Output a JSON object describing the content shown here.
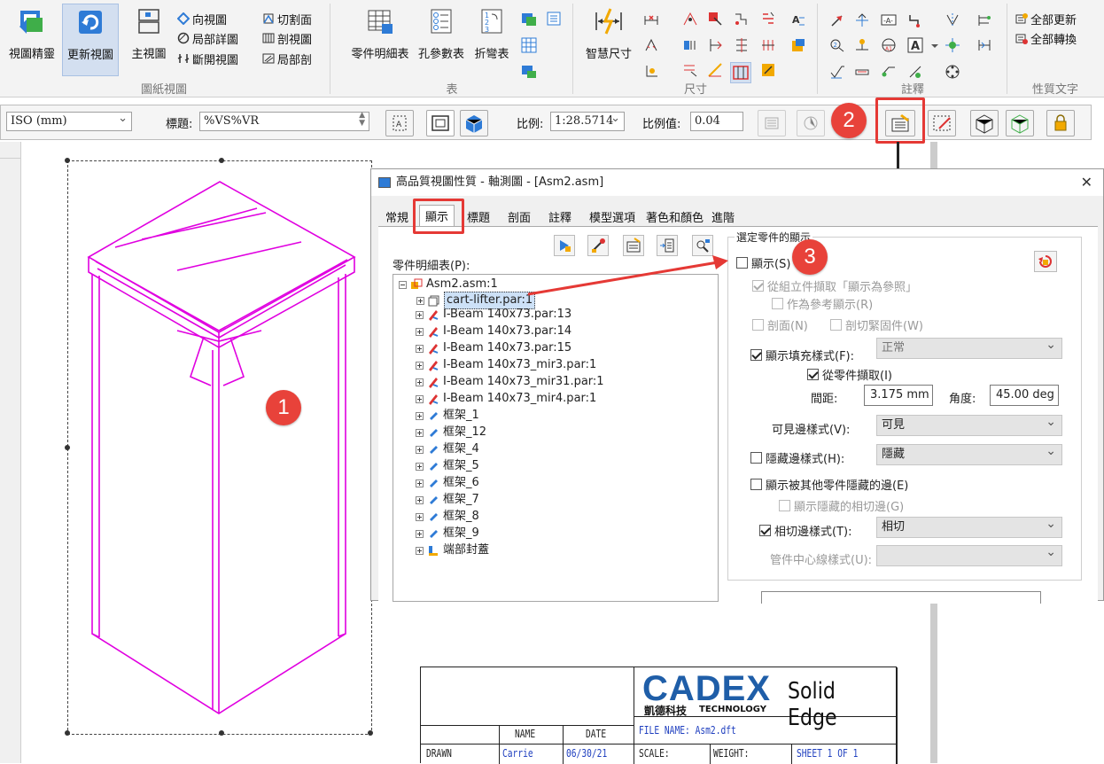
{
  "ribbon": {
    "groups": [
      {
        "label": "圖紙視圖"
      },
      {
        "label": "表"
      },
      {
        "label": "尺寸"
      },
      {
        "label": "註釋"
      },
      {
        "label": "性質文字"
      }
    ],
    "view_wizard": "視圖精靈",
    "update_views": "更新視圖",
    "principal_view": "主視圖",
    "auxiliary_view": "向視圖",
    "detail_view": "局部詳圖",
    "broken_view": "斷開視圖",
    "cutting_plane": "切割面",
    "section_view": "剖視圖",
    "broken_out": "局部剖",
    "parts_list": "零件明細表",
    "hole_table": "孔參數表",
    "bend_table": "折彎表",
    "smart_dimension": "智慧尺寸",
    "update_all": "全部更新",
    "convert_all": "全部轉換"
  },
  "cmdbar": {
    "standard": "ISO (mm)",
    "caption_label": "標題:",
    "caption_value": "%VS%VR",
    "scale_label": "比例:",
    "scale_value": "1:28.5714",
    "scale_val_label": "比例值:",
    "scale_val_value": "0.04"
  },
  "dialog": {
    "title": "高品質視圖性質 - 軸測圖 - [Asm2.asm]",
    "tabs": [
      "常規",
      "顯示",
      "標題",
      "剖面",
      "註釋",
      "模型選項",
      "著色和顏色",
      "進階"
    ],
    "parts_list_label": "零件明細表(P):",
    "tree": [
      {
        "label": "Asm2.asm:1",
        "icon": "assembly-icon"
      },
      {
        "label": "cart-lifter.par:1",
        "icon": "part-icon"
      },
      {
        "label": "I-Beam 140x73.par:13",
        "icon": "beam-icon"
      },
      {
        "label": "I-Beam 140x73.par:14",
        "icon": "beam-icon"
      },
      {
        "label": "I-Beam 140x73.par:15",
        "icon": "beam-icon"
      },
      {
        "label": "I-Beam 140x73_mir3.par:1",
        "icon": "beam-icon"
      },
      {
        "label": "I-Beam 140x73_mir31.par:1",
        "icon": "beam-icon"
      },
      {
        "label": "I-Beam 140x73_mir4.par:1",
        "icon": "beam-icon"
      },
      {
        "label": "框架_1",
        "icon": "frame-icon"
      },
      {
        "label": "框架_12",
        "icon": "frame-icon"
      },
      {
        "label": "框架_4",
        "icon": "frame-icon"
      },
      {
        "label": "框架_5",
        "icon": "frame-icon"
      },
      {
        "label": "框架_6",
        "icon": "frame-icon"
      },
      {
        "label": "框架_7",
        "icon": "frame-icon"
      },
      {
        "label": "框架_8",
        "icon": "frame-icon"
      },
      {
        "label": "框架_9",
        "icon": "frame-icon"
      },
      {
        "label": "端部封蓋",
        "icon": "endcap-icon"
      }
    ],
    "group_title": "選定零件的顯示",
    "show": "顯示(S)",
    "from_asm": "從組立件擷取「顯示為參照」",
    "as_ref": "作為參考顯示(R)",
    "section": "剖面(N)",
    "cut_fasteners": "剖切緊固件(W)",
    "show_fill": "顯示填充樣式(F):",
    "fill_value": "正常",
    "from_part": "從零件擷取(I)",
    "spacing_label": "間距:",
    "spacing_value": "3.175 mm",
    "angle_label": "角度:",
    "angle_value": "45.00 deg",
    "visible_edge_label": "可見邊樣式(V):",
    "visible_edge_value": "可見",
    "hidden_edge_label": "隱藏邊樣式(H):",
    "hidden_edge_value": "隱藏",
    "show_hidden_by_other": "顯示被其他零件隱藏的邊(E)",
    "show_hidden_tangent": "顯示隱藏的相切邊(G)",
    "tangent_edge_label": "相切邊樣式(T):",
    "tangent_edge_value": "相切",
    "tube_center_label": "管件中心線樣式(U):"
  },
  "badges": [
    "1",
    "2",
    "3"
  ],
  "titleblock": {
    "logo": "CADEX",
    "logo_cn": "凱德科技",
    "logo_en": "TECHNOLOGY",
    "product": "Solid Edge",
    "name_hdr": "NAME",
    "date_hdr": "DATE",
    "drawn": "DRAWN",
    "drawn_name": "Carrie",
    "drawn_date": "06/30/21",
    "file_name": "FILE NAME: Asm2.dft",
    "scale": "SCALE:",
    "weight": "WEIGHT:",
    "sheet": "SHEET 1 OF 1"
  },
  "colors": {
    "accent_red": "#e53935",
    "model_magenta": "#e000e0",
    "logo_blue": "#1f5ea8"
  }
}
